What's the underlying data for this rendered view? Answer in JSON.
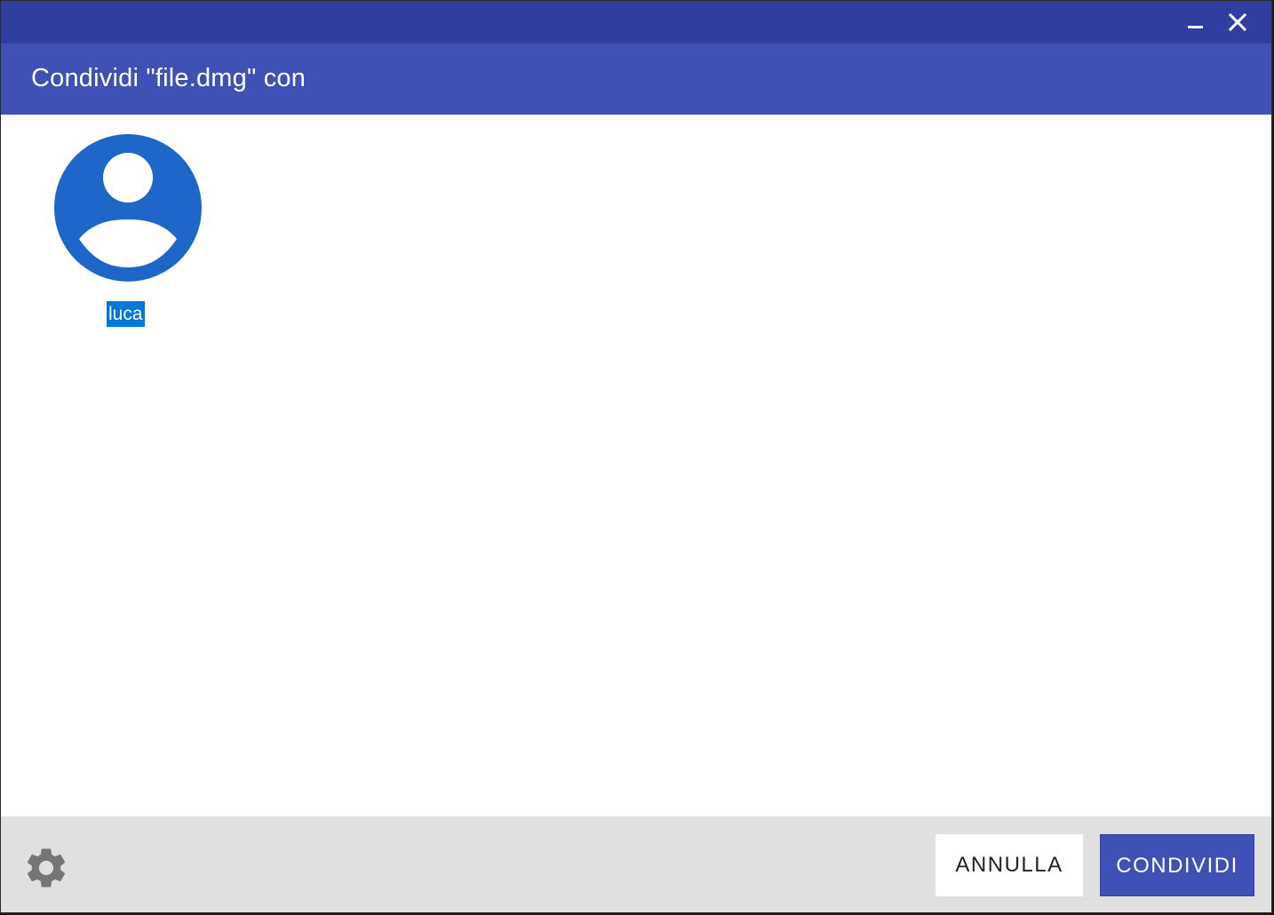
{
  "dialog": {
    "title": "Condividi \"file.dmg\" con"
  },
  "window_controls": {
    "minimize_icon": "minimize-icon",
    "close_icon": "close-icon"
  },
  "contacts": [
    {
      "name": "luca",
      "icon": "user-avatar-icon",
      "selected": true
    }
  ],
  "footer": {
    "settings_icon": "gear-icon",
    "cancel_label": "ANNULLA",
    "share_label": "CONDIVIDI"
  },
  "colors": {
    "titlebar": "#303f9f",
    "header": "#3f51b5",
    "avatar": "#1e66c8",
    "selection": "#0078d7",
    "footer": "#e0e0e0",
    "primary_button": "#3f51b5"
  }
}
